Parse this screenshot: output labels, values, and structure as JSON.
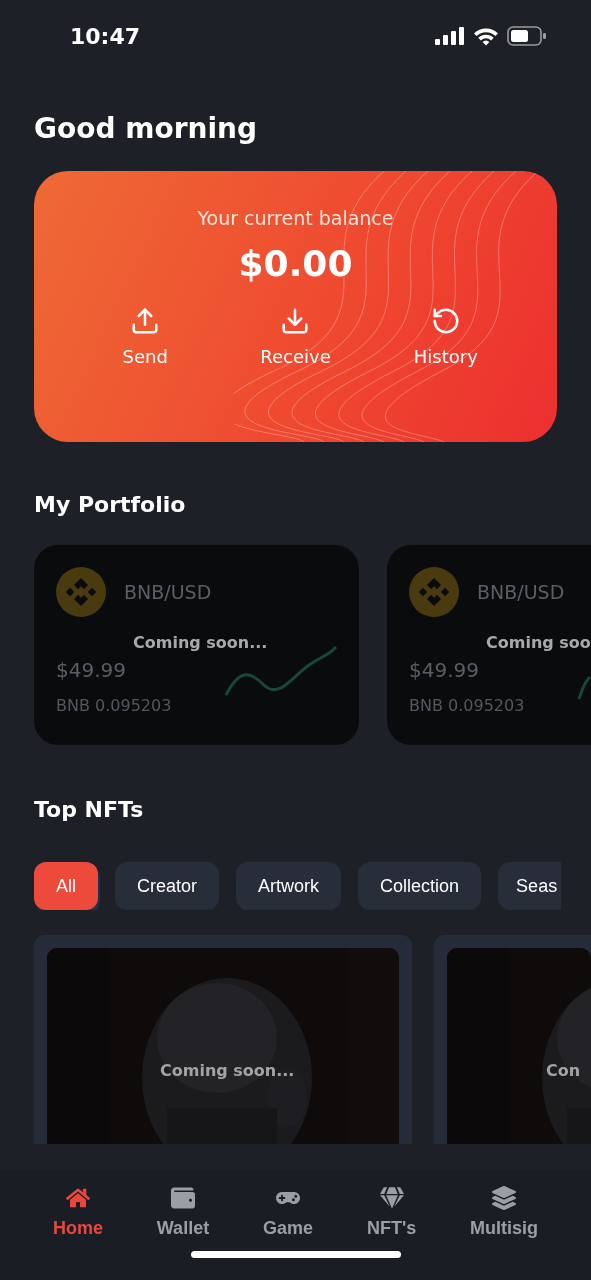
{
  "status_bar": {
    "time": "10:47"
  },
  "greeting": "Good morning",
  "balance": {
    "label": "Your current balance",
    "amount": "$0.00",
    "actions": [
      {
        "label": "Send",
        "kind": "send"
      },
      {
        "label": "Receive",
        "kind": "receive"
      },
      {
        "label": "History",
        "kind": "history"
      }
    ]
  },
  "portfolio": {
    "title": "My Portfolio",
    "cards": [
      {
        "pair": "BNB/USD",
        "price": "$49.99",
        "holding": "BNB 0.095203",
        "overlay": "Coming soon..."
      },
      {
        "pair": "BNB/USD",
        "price": "$49.99",
        "holding": "BNB 0.095203",
        "overlay": "Coming soo"
      }
    ]
  },
  "top_nfts": {
    "title": "Top NFTs",
    "filters": [
      {
        "label": "All",
        "selected": true
      },
      {
        "label": "Creator",
        "selected": false
      },
      {
        "label": "Artwork",
        "selected": false
      },
      {
        "label": "Collection",
        "selected": false
      },
      {
        "label": "Seas",
        "selected": false
      }
    ],
    "cards": [
      {
        "overlay": "Coming soon..."
      },
      {
        "overlay": "Con"
      }
    ]
  },
  "nav": [
    {
      "label": "Home",
      "kind": "home",
      "selected": true
    },
    {
      "label": "Wallet",
      "kind": "wallet",
      "selected": false
    },
    {
      "label": "Game",
      "kind": "game",
      "selected": false
    },
    {
      "label": "NFT's",
      "kind": "nft",
      "selected": false
    },
    {
      "label": "Multisig",
      "kind": "multisig",
      "selected": false
    }
  ]
}
